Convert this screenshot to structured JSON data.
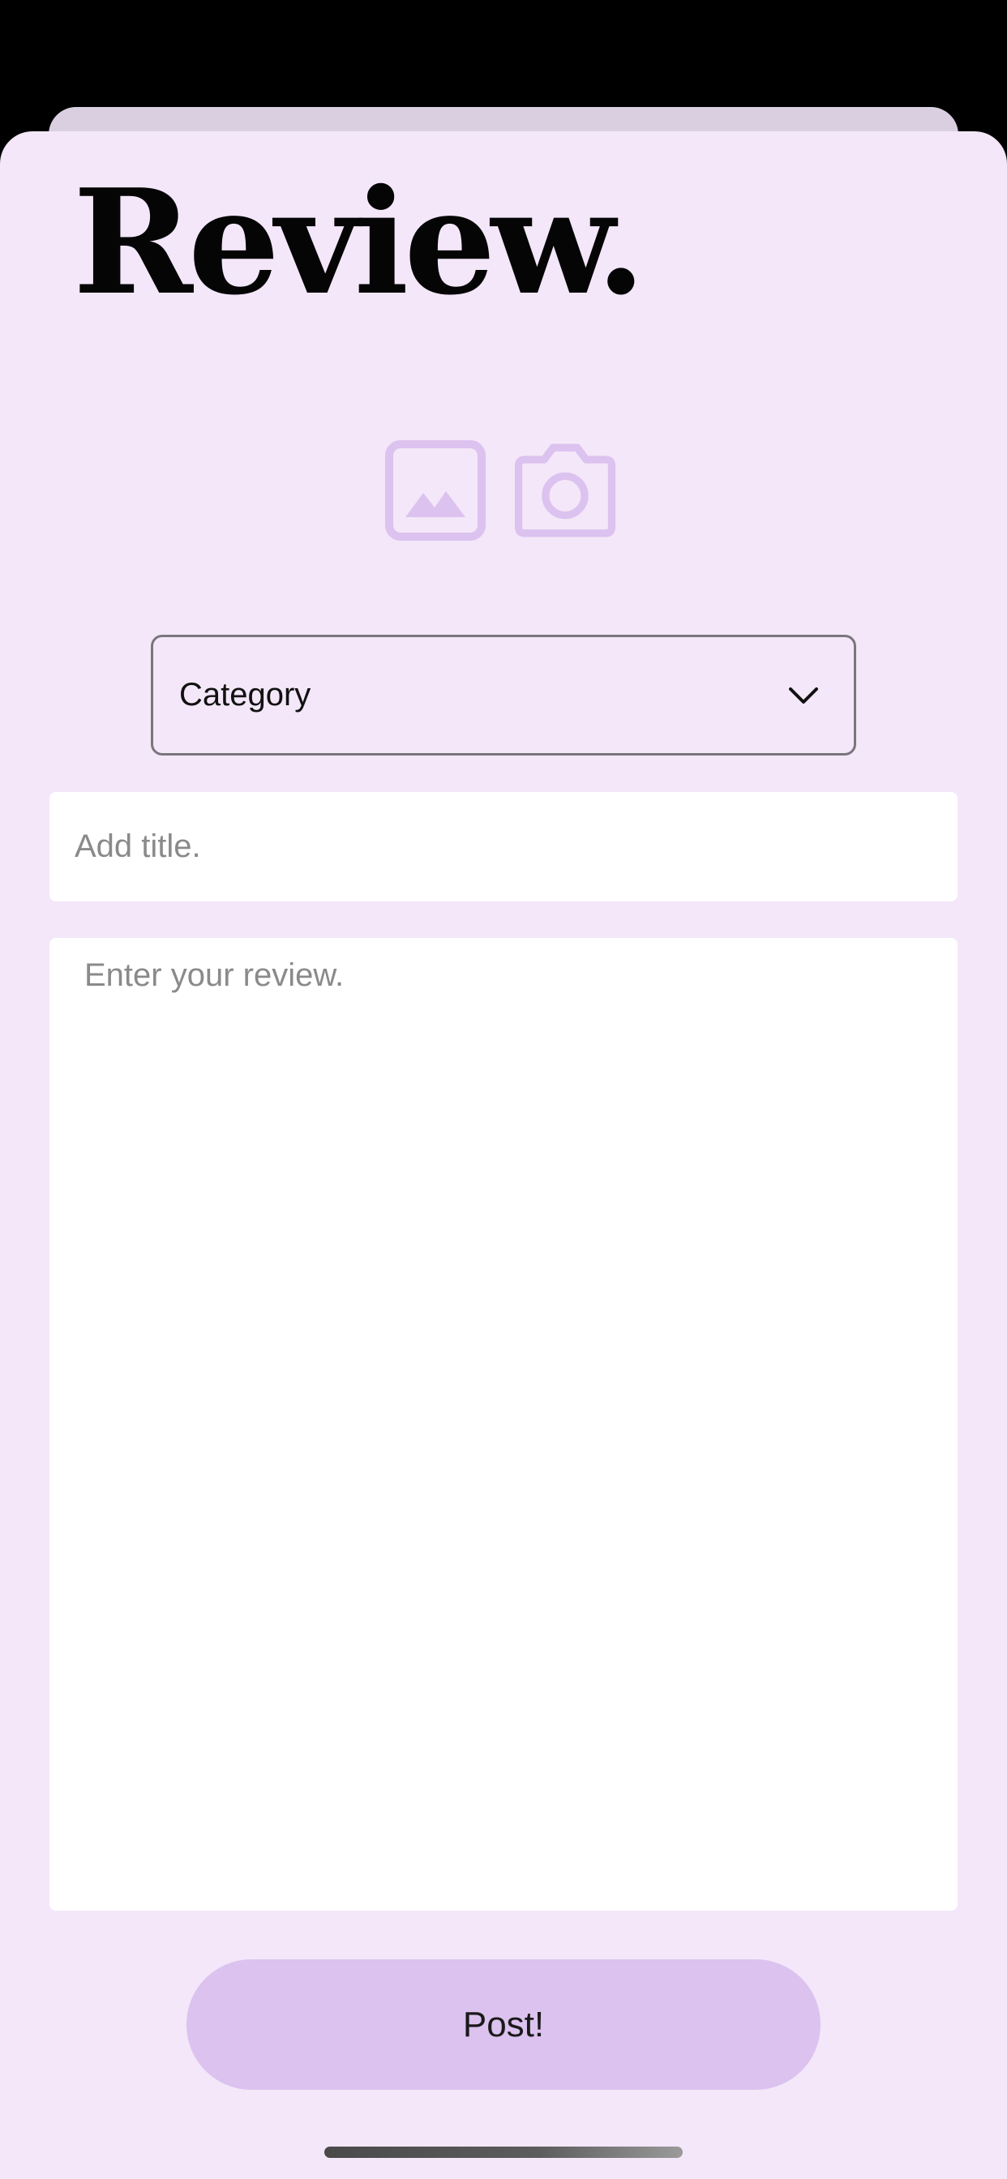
{
  "header": {
    "title": "Review."
  },
  "media": {
    "gallery_icon": "image-gallery-icon",
    "camera_icon": "camera-icon",
    "icon_color": "#dcc2ef"
  },
  "form": {
    "category": {
      "selected_label": "Category",
      "icon": "chevron-down-icon"
    },
    "title_input": {
      "value": "",
      "placeholder": "Add title."
    },
    "review_input": {
      "value": "",
      "placeholder": "Enter your review."
    },
    "post_button_label": "Post!"
  },
  "colors": {
    "background": "#f3e7f9",
    "accent": "#dcc2ef",
    "field": "#ffffff"
  }
}
